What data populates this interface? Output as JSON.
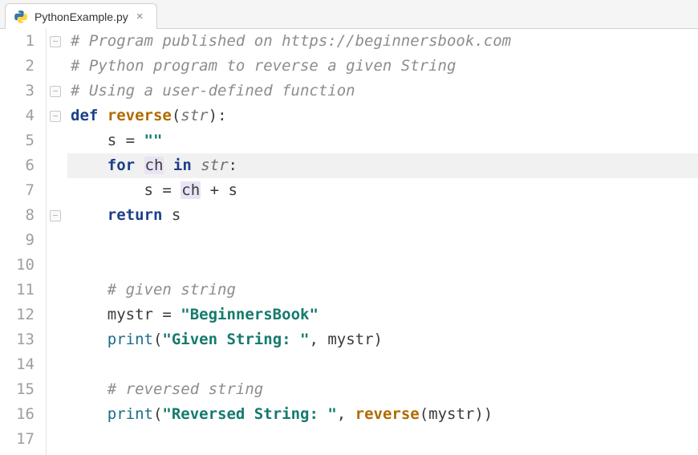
{
  "file_icon": "python-file-icon",
  "tab": {
    "filename": "PythonExample.py",
    "close_glyph": "×"
  },
  "editor": {
    "highlighted_line": 6,
    "line_count": 17,
    "fold_markers": [
      {
        "line": 1,
        "glyph": "–"
      },
      {
        "line": 3,
        "glyph": "–"
      },
      {
        "line": 4,
        "glyph": "–"
      },
      {
        "line": 8,
        "glyph": "–"
      }
    ],
    "code": {
      "l1": {
        "comment": "# Program published on https://beginnersbook.com"
      },
      "l2": {
        "comment": "# Python program to reverse a given String"
      },
      "l3": {
        "comment": "# Using a user-defined function"
      },
      "l4": {
        "kw_def": "def ",
        "fn": "reverse",
        "open": "(",
        "param": "str",
        "close": "):"
      },
      "l5": {
        "indent": "    ",
        "var": "s ",
        "op": "= ",
        "str": "\"\""
      },
      "l6": {
        "indent": "    ",
        "kw_for": "for ",
        "var": "ch",
        "sp1": " ",
        "kw_in": "in ",
        "param": "str",
        "colon": ":"
      },
      "l7": {
        "indent": "        ",
        "var_s": "s ",
        "op": "= ",
        "var_ch": "ch",
        "rest": " + s"
      },
      "l8": {
        "indent": "    ",
        "kw_return": "return ",
        "var": "s"
      },
      "l9": {
        "blank": ""
      },
      "l10": {
        "blank": ""
      },
      "l11": {
        "indent1": "    ",
        "comment": "# given string"
      },
      "l12": {
        "indent1": "    ",
        "var": "mystr ",
        "op": "= ",
        "str": "\"BeginnersBook\""
      },
      "l13": {
        "indent1": "    ",
        "builtin": "print",
        "open": "(",
        "str": "\"Given String: \"",
        "rest": ", mystr)"
      },
      "l14": {
        "blank": ""
      },
      "l15": {
        "indent1": "    ",
        "comment": "# reversed string"
      },
      "l16": {
        "indent1": "    ",
        "builtin": "print",
        "open": "(",
        "str": "\"Reversed String: \"",
        "comma": ", ",
        "fn": "reverse",
        "arg": "(mystr))"
      },
      "l17": {
        "blank": ""
      }
    }
  }
}
